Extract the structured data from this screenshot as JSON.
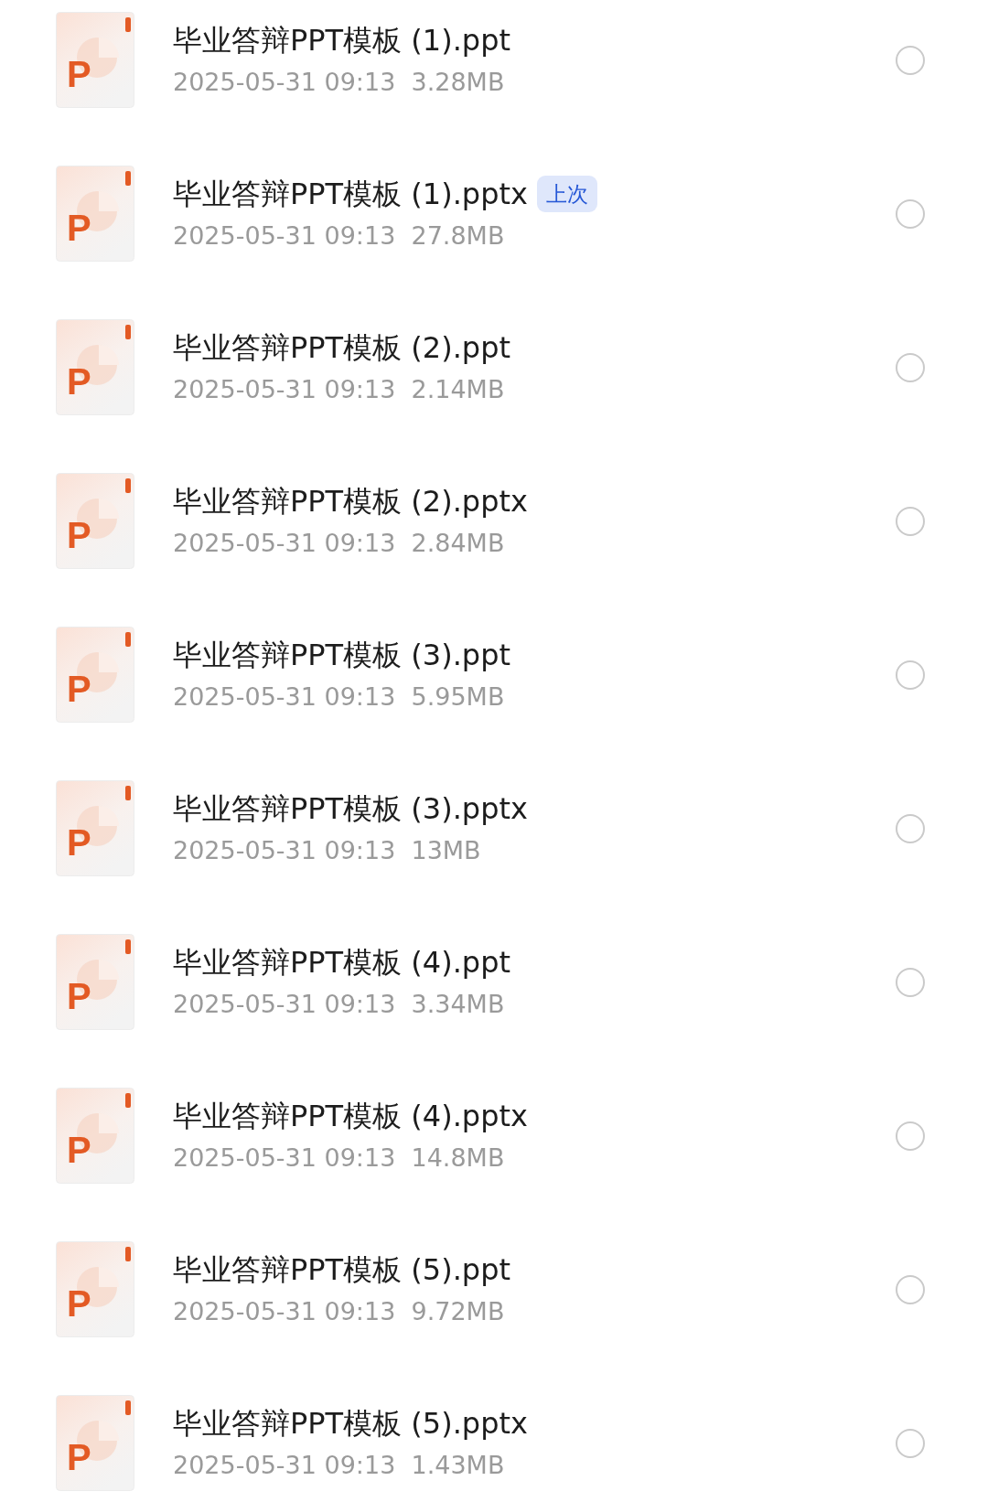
{
  "files": [
    {
      "icon_letter": "P",
      "name": "毕业答辩PPT模板 (1).ppt",
      "date": "2025-05-31 09:13",
      "size": "3.28MB",
      "selected": false
    },
    {
      "icon_letter": "P",
      "name": "毕业答辩PPT模板 (1).pptx",
      "badge": "上次",
      "date": "2025-05-31 09:13",
      "size": "27.8MB",
      "selected": false
    },
    {
      "icon_letter": "P",
      "name": "毕业答辩PPT模板 (2).ppt",
      "date": "2025-05-31 09:13",
      "size": "2.14MB",
      "selected": false
    },
    {
      "icon_letter": "P",
      "name": "毕业答辩PPT模板 (2).pptx",
      "date": "2025-05-31 09:13",
      "size": "2.84MB",
      "selected": false
    },
    {
      "icon_letter": "P",
      "name": "毕业答辩PPT模板 (3).ppt",
      "date": "2025-05-31 09:13",
      "size": "5.95MB",
      "selected": false
    },
    {
      "icon_letter": "P",
      "name": "毕业答辩PPT模板 (3).pptx",
      "date": "2025-05-31 09:13",
      "size": "13MB",
      "selected": false
    },
    {
      "icon_letter": "P",
      "name": "毕业答辩PPT模板 (4).ppt",
      "date": "2025-05-31 09:13",
      "size": "3.34MB",
      "selected": false
    },
    {
      "icon_letter": "P",
      "name": "毕业答辩PPT模板 (4).pptx",
      "date": "2025-05-31 09:13",
      "size": "14.8MB",
      "selected": false
    },
    {
      "icon_letter": "P",
      "name": "毕业答辩PPT模板 (5).ppt",
      "date": "2025-05-31 09:13",
      "size": "9.72MB",
      "selected": false
    },
    {
      "icon_letter": "P",
      "name": "毕业答辩PPT模板 (5).pptx",
      "date": "2025-05-31 09:13",
      "size": "1.43MB",
      "selected": false
    }
  ]
}
